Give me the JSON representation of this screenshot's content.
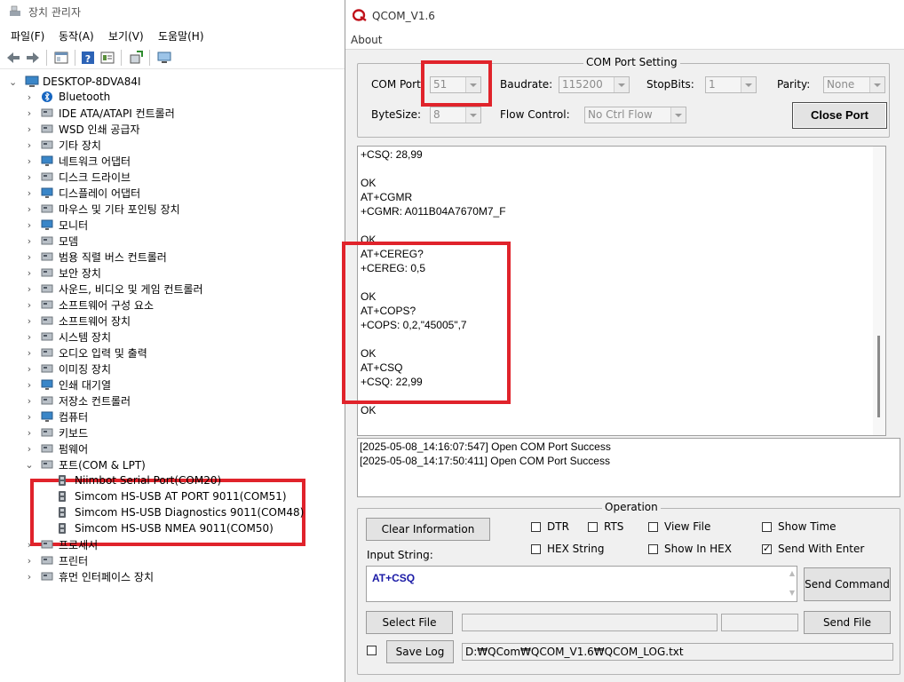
{
  "device_manager": {
    "title": "장치 관리자",
    "menu": [
      "파일(F)",
      "동작(A)",
      "보기(V)",
      "도움말(H)"
    ],
    "computer_name": "DESKTOP-8DVA84I",
    "categories": [
      {
        "label": "Bluetooth",
        "icon": "bluetooth-icon"
      },
      {
        "label": "IDE ATA/ATAPI 컨트롤러",
        "icon": "ide-controller-icon"
      },
      {
        "label": "WSD 인쇄 공급자",
        "icon": "printer-icon"
      },
      {
        "label": "기타 장치",
        "icon": "unknown-device-icon"
      },
      {
        "label": "네트워크 어댑터",
        "icon": "network-adapter-icon"
      },
      {
        "label": "디스크 드라이브",
        "icon": "disk-drive-icon"
      },
      {
        "label": "디스플레이 어댑터",
        "icon": "display-adapter-icon"
      },
      {
        "label": "마우스 및 기타 포인팅 장치",
        "icon": "mouse-icon"
      },
      {
        "label": "모니터",
        "icon": "monitor-icon"
      },
      {
        "label": "모뎀",
        "icon": "modem-icon"
      },
      {
        "label": "범용 직렬 버스 컨트롤러",
        "icon": "usb-icon"
      },
      {
        "label": "보안 장치",
        "icon": "security-device-icon"
      },
      {
        "label": "사운드, 비디오 및 게임 컨트롤러",
        "icon": "sound-icon"
      },
      {
        "label": "소프트웨어 구성 요소",
        "icon": "software-component-icon"
      },
      {
        "label": "소프트웨어 장치",
        "icon": "software-device-icon"
      },
      {
        "label": "시스템 장치",
        "icon": "system-device-icon"
      },
      {
        "label": "오디오 입력 및 출력",
        "icon": "audio-icon"
      },
      {
        "label": "이미징 장치",
        "icon": "camera-icon"
      },
      {
        "label": "인쇄 대기열",
        "icon": "print-queue-icon"
      },
      {
        "label": "저장소 컨트롤러",
        "icon": "storage-controller-icon"
      },
      {
        "label": "컴퓨터",
        "icon": "computer-icon"
      },
      {
        "label": "키보드",
        "icon": "keyboard-icon"
      },
      {
        "label": "펌웨어",
        "icon": "firmware-icon"
      },
      {
        "label": "포트(COM & LPT)",
        "icon": "port-icon"
      },
      {
        "label": "프로세서",
        "icon": "processor-icon"
      },
      {
        "label": "프린터",
        "icon": "printer-icon"
      },
      {
        "label": "휴먼 인터페이스 장치",
        "icon": "hid-icon"
      }
    ],
    "ports": [
      "Niimbot Serial Port(COM20)",
      "Simcom HS-USB AT PORT 9011(COM51)",
      "Simcom HS-USB Diagnostics 9011(COM48)",
      "Simcom HS-USB NMEA 9011(COM50)"
    ]
  },
  "qcom": {
    "title": "QCOM_V1.6",
    "menu_about": "About",
    "settings": {
      "group_title": "COM Port Setting",
      "com_port_label": "COM Port",
      "com_port_value": "51",
      "baudrate_label": "Baudrate:",
      "baudrate_value": "115200",
      "stopbits_label": "StopBits:",
      "stopbits_value": "1",
      "parity_label": "Parity:",
      "parity_value": "None",
      "bytesize_label": "ByteSize:",
      "bytesize_value": "8",
      "flow_label": "Flow Control:",
      "flow_value": "No Ctrl Flow",
      "close_port": "Close Port"
    },
    "receive_lines": [
      "+CSQ: 28,99",
      "",
      "OK",
      "AT+CGMR",
      "+CGMR: A011B04A7670M7_F",
      "",
      "OK",
      "AT+CEREG?",
      "+CEREG: 0,5",
      "",
      "OK",
      "AT+COPS?",
      "+COPS: 0,2,\"45005\",7",
      "",
      "OK",
      "AT+CSQ",
      "+CSQ: 22,99",
      "",
      "OK"
    ],
    "status_lines": [
      "[2025-05-08_14:16:07:547] Open COM Port Success",
      "[2025-05-08_14:17:50:411] Open COM Port Success"
    ],
    "operation": {
      "group_title": "Operation",
      "clear_info": "Clear Information",
      "dtr": "DTR",
      "rts": "RTS",
      "view_file": "View File",
      "show_time": "Show Time",
      "hex_string": "HEX String",
      "show_in_hex": "Show In HEX",
      "send_with_enter": "Send With Enter",
      "send_with_enter_checked": true,
      "input_label": "Input String:",
      "input_value": "AT+CSQ",
      "send_command": "Send Command",
      "select_file": "Select File",
      "send_file": "Send File",
      "save_log": "Save Log",
      "log_path": "D:₩QCom₩QCOM_V1.6₩QCOM_LOG.txt"
    }
  },
  "colors": {
    "highlight": "#e0232b",
    "input_text": "#1a1aa6"
  }
}
